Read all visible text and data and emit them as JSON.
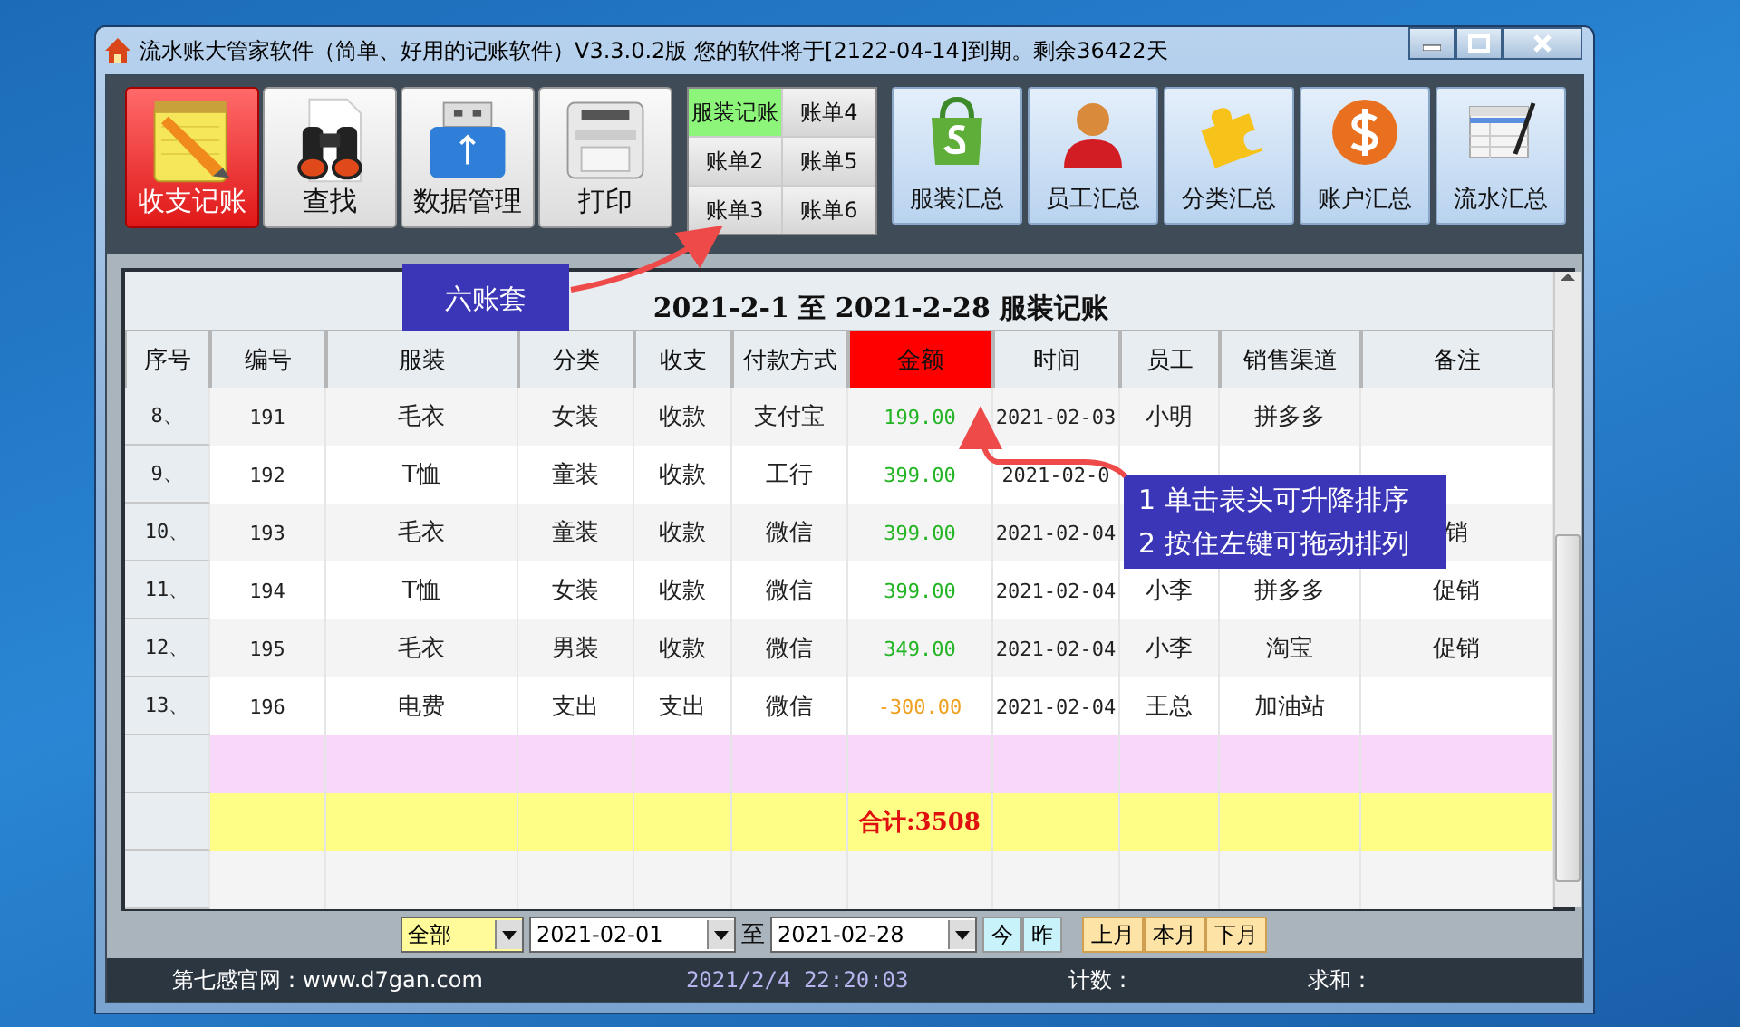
{
  "window": {
    "title": "流水账大管家软件（简单、好用的记账软件）V3.3.0.2版 您的软件将于[2122-04-14]到期。剩余36422天"
  },
  "toolbar": {
    "main_buttons": [
      {
        "label": "收支记账",
        "selected": true
      },
      {
        "label": "查找",
        "selected": false
      },
      {
        "label": "数据管理",
        "selected": false
      },
      {
        "label": "打印",
        "selected": false
      }
    ],
    "ledger_tabs": [
      {
        "label": "服装记账",
        "selected": true
      },
      {
        "label": "账单4",
        "selected": false
      },
      {
        "label": "账单2",
        "selected": false
      },
      {
        "label": "账单5",
        "selected": false
      },
      {
        "label": "账单3",
        "selected": false
      },
      {
        "label": "账单6",
        "selected": false
      }
    ],
    "summary_buttons": [
      "服装汇总",
      "员工汇总",
      "分类汇总",
      "账户汇总",
      "流水汇总"
    ]
  },
  "table": {
    "title": "2021-2-1  至  2021-2-28  服装记账",
    "columns": [
      {
        "label": "序号",
        "selected": false
      },
      {
        "label": "编号",
        "selected": false
      },
      {
        "label": "服装",
        "selected": false
      },
      {
        "label": "分类",
        "selected": false
      },
      {
        "label": "收支",
        "selected": false
      },
      {
        "label": "付款方式",
        "selected": false
      },
      {
        "label": "金额",
        "selected": true
      },
      {
        "label": "时间",
        "selected": false
      },
      {
        "label": "员工",
        "selected": false
      },
      {
        "label": "销售渠道",
        "selected": false
      },
      {
        "label": "备注",
        "selected": false
      }
    ],
    "rows": [
      {
        "kind": "income",
        "cells": [
          "8、",
          "191",
          "毛衣",
          "女装",
          "收款",
          "支付宝",
          "199.00",
          "2021-02-03",
          "小明",
          "拼多多",
          ""
        ]
      },
      {
        "kind": "income",
        "cells": [
          "9、",
          "192",
          "T恤",
          "童装",
          "收款",
          "工行",
          "399.00",
          "2021-02-0",
          "",
          "",
          ""
        ]
      },
      {
        "kind": "income",
        "cells": [
          "10、",
          "193",
          "毛衣",
          "童装",
          "收款",
          "微信",
          "399.00",
          "2021-02-04",
          "",
          "",
          "销"
        ]
      },
      {
        "kind": "income",
        "cells": [
          "11、",
          "194",
          "T恤",
          "女装",
          "收款",
          "微信",
          "399.00",
          "2021-02-04",
          "小李",
          "拼多多",
          "促销"
        ]
      },
      {
        "kind": "income",
        "cells": [
          "12、",
          "195",
          "毛衣",
          "男装",
          "收款",
          "微信",
          "349.00",
          "2021-02-04",
          "小李",
          "淘宝",
          "促销"
        ]
      },
      {
        "kind": "expense",
        "cells": [
          "13、",
          "196",
          "电费",
          "支出",
          "支出",
          "微信",
          "-300.00",
          "2021-02-04",
          "王总",
          "加油站",
          ""
        ]
      }
    ],
    "total": "合计:3508"
  },
  "filter": {
    "category": "全部",
    "date_from": "2021-02-01",
    "to_label": "至",
    "date_to": "2021-02-28",
    "day_buttons": [
      "今",
      "昨"
    ],
    "month_buttons": [
      "上月",
      "本月",
      "下月"
    ]
  },
  "status_bar": {
    "website": "第七感官网：www.d7gan.com",
    "datetime": "2021/2/4 22:20:03",
    "count_label": "计数：",
    "sum_label": "求和："
  },
  "callouts": [
    {
      "lines": [
        "六账套"
      ]
    },
    {
      "lines": [
        "1 单击表头可升降排序",
        "2 按住左键可拖动排列"
      ]
    }
  ]
}
